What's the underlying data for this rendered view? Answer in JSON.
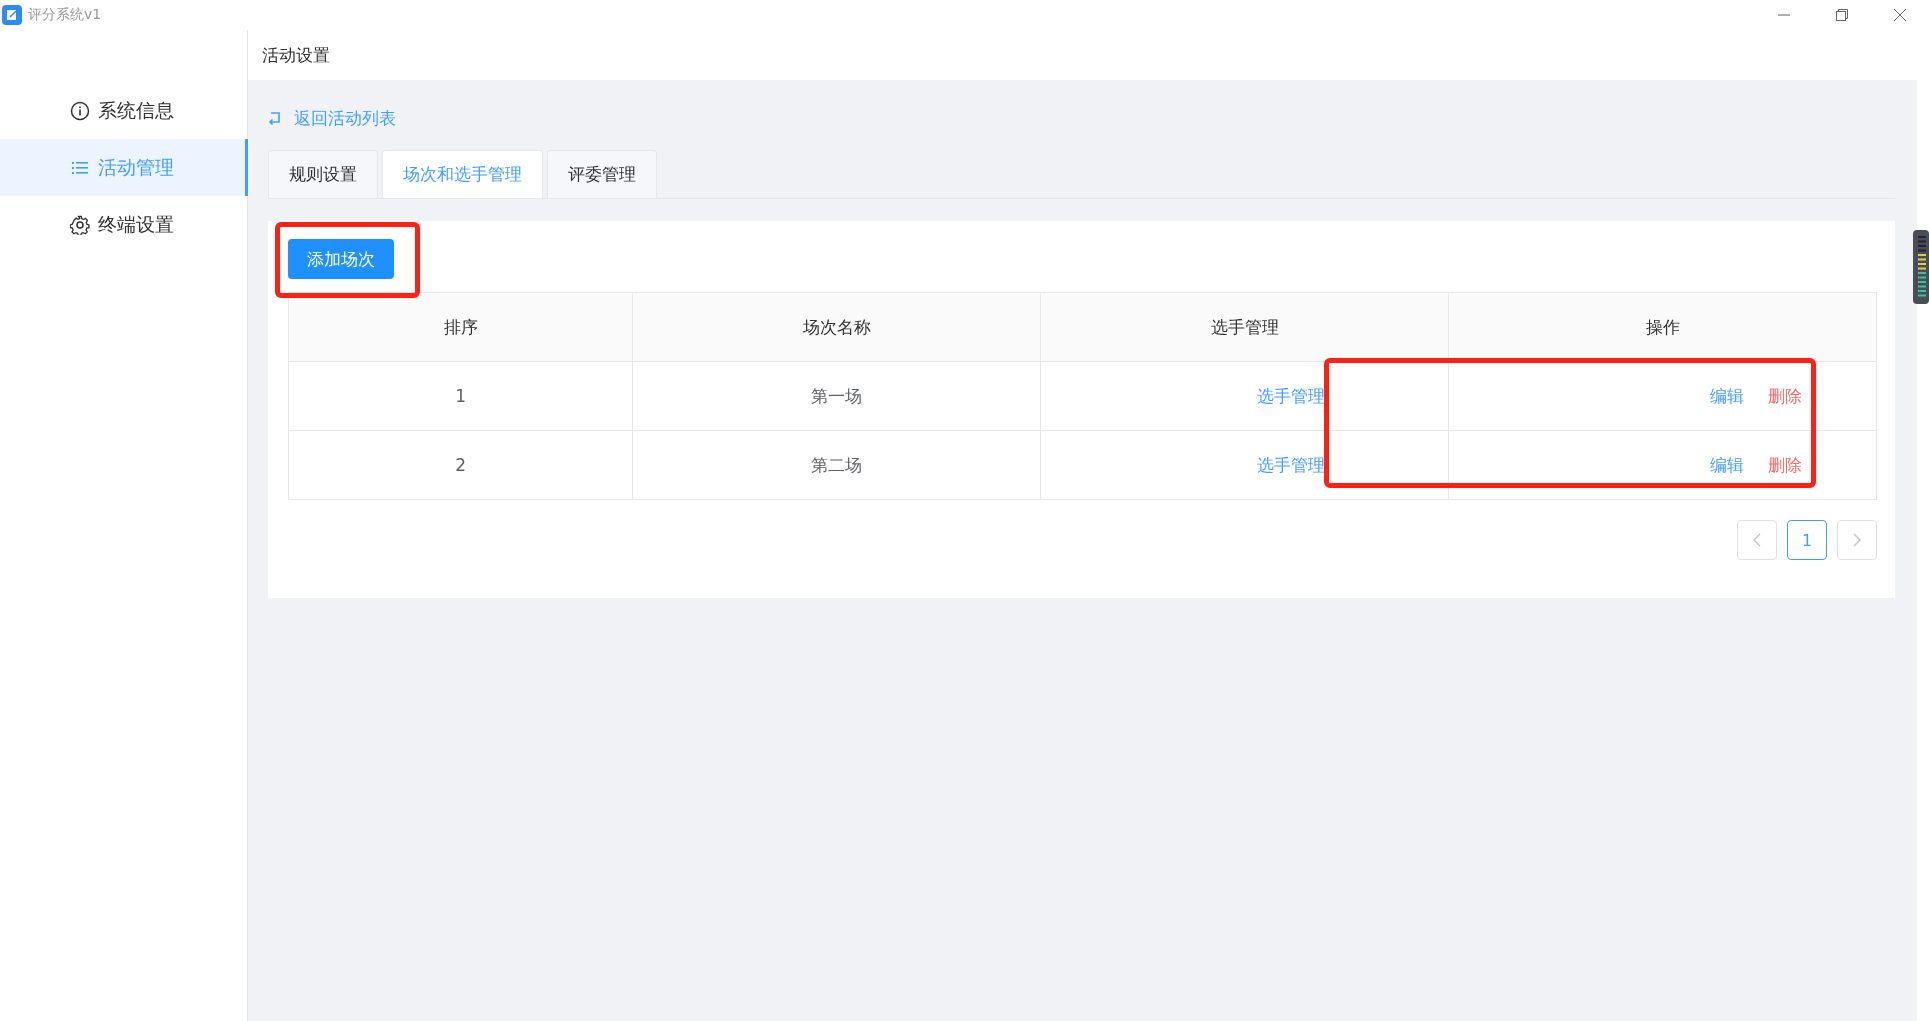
{
  "window": {
    "title": "评分系统v1"
  },
  "sidebar": {
    "items": [
      {
        "label": "系统信息",
        "selected": false
      },
      {
        "label": "活动管理",
        "selected": true
      },
      {
        "label": "终端设置",
        "selected": false
      }
    ]
  },
  "header": {
    "title": "活动设置"
  },
  "back_link": "返回活动列表",
  "tabs": [
    {
      "label": "规则设置",
      "selected": false
    },
    {
      "label": "场次和选手管理",
      "selected": true
    },
    {
      "label": "评委管理",
      "selected": false
    }
  ],
  "add_button": "添加场次",
  "table": {
    "columns": [
      "排序",
      "场次名称",
      "选手管理",
      "操作"
    ],
    "rows": [
      {
        "order": "1",
        "name": "第一场",
        "players_link": "选手管理",
        "edit": "编辑",
        "delete": "删除"
      },
      {
        "order": "2",
        "name": "第二场",
        "players_link": "选手管理",
        "edit": "编辑",
        "delete": "删除"
      }
    ]
  },
  "pagination": {
    "pages": [
      {
        "label": "1",
        "selected": true
      }
    ]
  }
}
